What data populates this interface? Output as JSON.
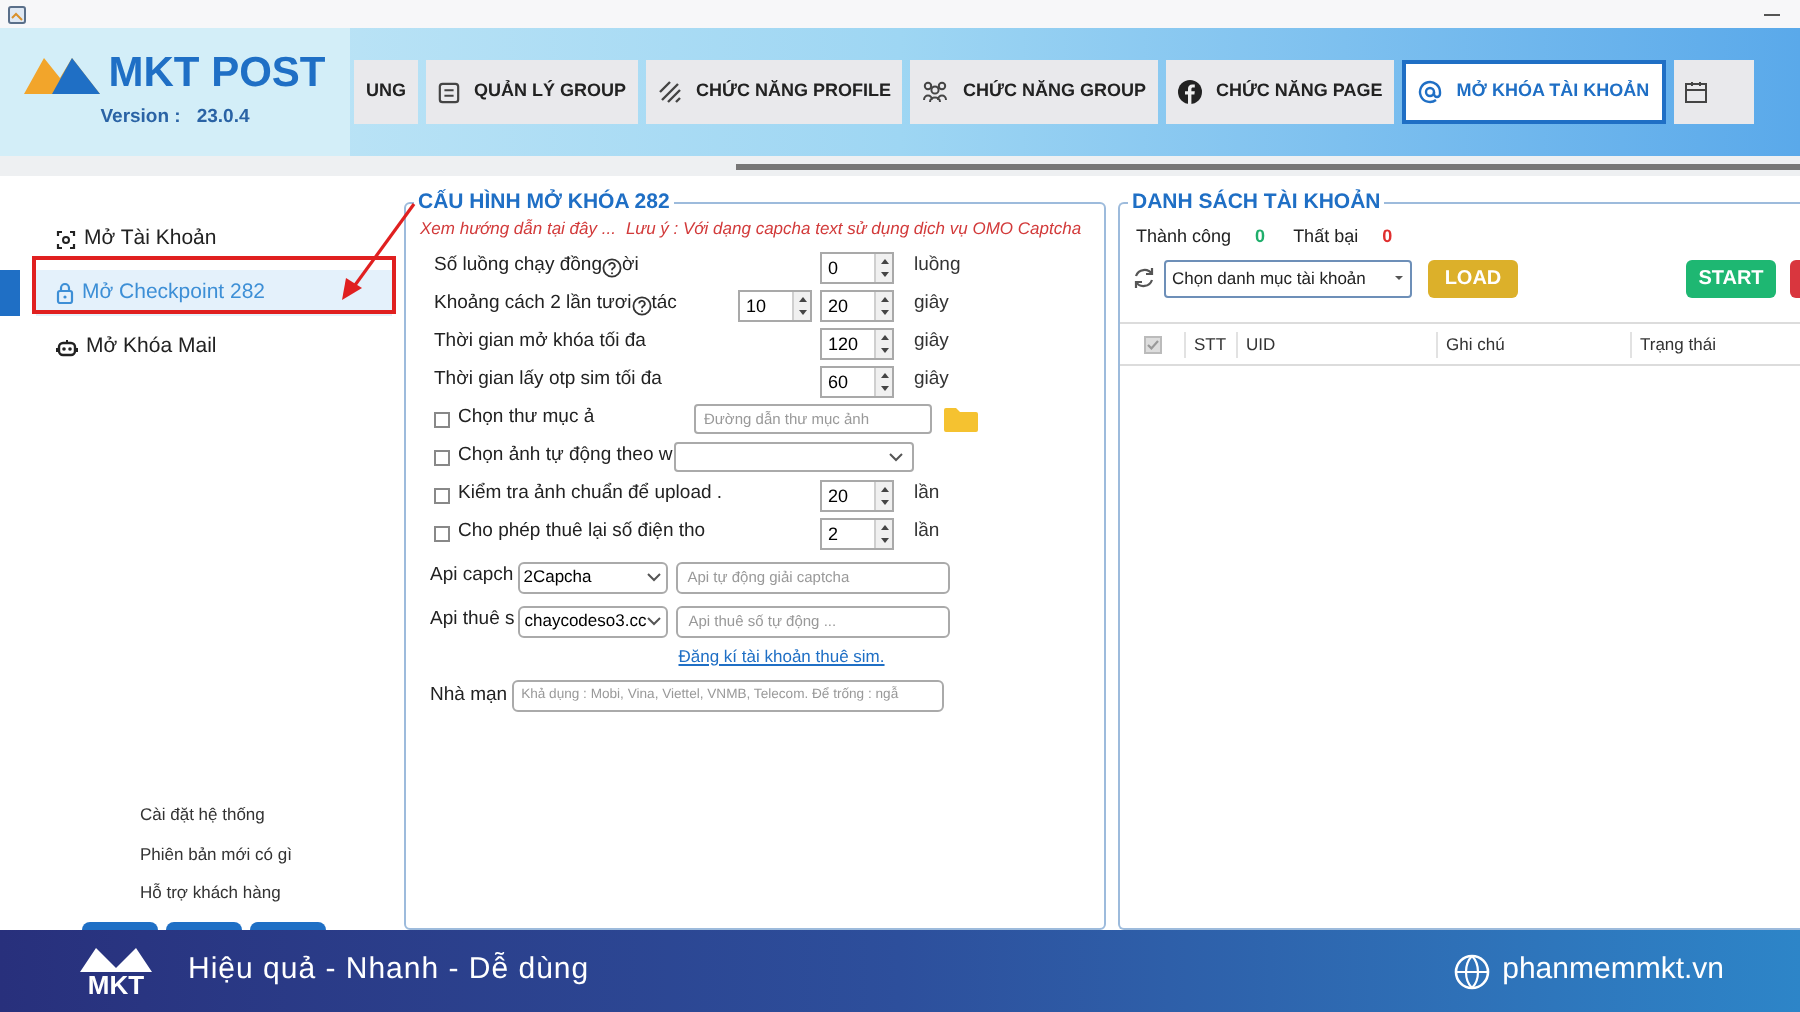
{
  "header": {
    "logo": "MKT POST",
    "version_label": "Version :",
    "version": "23.0.4"
  },
  "tabs": [
    {
      "label": "UNG",
      "kind": "plain",
      "selected": false
    },
    {
      "label": "QUẢN LÝ GROUP",
      "kind": "list",
      "selected": false
    },
    {
      "label": "CHỨC NĂNG PROFILE",
      "kind": "stripes",
      "selected": false
    },
    {
      "label": "CHỨC NĂNG GROUP",
      "kind": "people",
      "selected": false
    },
    {
      "label": "CHỨC NĂNG PAGE",
      "kind": "facebook",
      "selected": false
    },
    {
      "label": "MỞ KHÓA TÀI KHOẢN",
      "kind": "at",
      "selected": true
    }
  ],
  "sidebar": {
    "items": [
      {
        "label": "Mở Tài Khoản",
        "kind": "scan",
        "selected": false
      },
      {
        "label": "Mở Checkpoint 282",
        "kind": "lock",
        "selected": true
      },
      {
        "label": "Mở Khóa Mail",
        "kind": "robot",
        "selected": false
      }
    ],
    "links": [
      "Cài đặt hệ thống",
      "Phiên bản mới có gì",
      "Hỗ trợ khách hàng"
    ]
  },
  "config": {
    "title": "CẤU HÌNH MỞ KHÓA 282",
    "guide_link": "Xem hướng dẫn tại đây ...",
    "note": "Lưu ý : Với dạng capcha text sử dụng dịch vụ OMO Captcha",
    "rows": [
      {
        "kind": "spin",
        "label": "Số luồng chạy đồng",
        "label_tail": "ời",
        "values": [
          "0"
        ],
        "unit": "luồng"
      },
      {
        "kind": "spin",
        "label": "Khoảng cách 2 lần tươi",
        "label_tail": "tác",
        "values": [
          "10",
          "20"
        ],
        "unit": "giây"
      },
      {
        "kind": "spin",
        "label": "Thời gian mở khóa tối đa",
        "values": [
          "120"
        ],
        "unit": "giây"
      },
      {
        "kind": "spin",
        "label": "Thời gian lấy otp sim tối đa",
        "values": [
          "60"
        ],
        "unit": "giây"
      },
      {
        "kind": "check_path",
        "label": "Chọn thư mục ả",
        "checked": false,
        "placeholder": "Đường dẫn thư mục ảnh"
      },
      {
        "kind": "check_dropdown",
        "label": "Chọn ảnh tự động theo w",
        "checked": false
      },
      {
        "kind": "check_spin",
        "label": "Kiểm tra ảnh chuẩn để upload .",
        "checked": false,
        "values": [
          "20"
        ],
        "unit": "lần"
      },
      {
        "kind": "check_spin",
        "label": "Cho phép thuê lại số điện tho",
        "checked": false,
        "values": [
          "2"
        ],
        "unit": "lần"
      },
      {
        "kind": "api_select",
        "label": "Api capch",
        "value": "2Capcha",
        "placeholder": "Api tự động giải captcha"
      },
      {
        "kind": "api_select",
        "label": "Api thuê s",
        "value": "chaycodeso3.cc",
        "placeholder": "Api thuê số tự động ...",
        "link": "Đăng kí tài khoản thuê sim."
      },
      {
        "kind": "api_text",
        "label": "Nhà mạn",
        "placeholder": "Khả dụng : Mobi, Vina, Viettel, VNMB, Telecom. Để trống : ngẫ"
      }
    ]
  },
  "accounts": {
    "title": "DANH SÁCH TÀI KHOẢN",
    "stats": [
      {
        "label": "Thành công",
        "value": "0",
        "color": "#1fae6b"
      },
      {
        "label": "Thất bại",
        "value": "0",
        "color": "#e02f2f"
      }
    ],
    "category": "Chọn danh mục tài khoản",
    "load": "LOAD",
    "start": "START",
    "table": {
      "select_all_checked": true,
      "columns": [
        "STT",
        "UID",
        "Ghi chú",
        "Trạng thái"
      ]
    }
  },
  "footer": {
    "slogan": "Hiệu quả - Nhanh - Dễ dùng",
    "logo": "MKT",
    "website": "phanmemmkt.vn"
  }
}
